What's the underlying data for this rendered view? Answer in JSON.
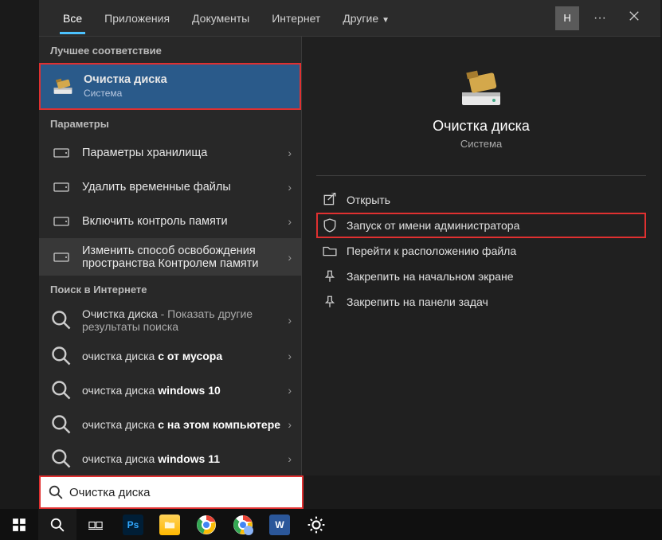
{
  "tabs": {
    "all": "Все",
    "apps": "Приложения",
    "docs": "Документы",
    "web": "Интернет",
    "other": "Другие"
  },
  "avatar_letter": "Н",
  "sections": {
    "best": "Лучшее соответствие",
    "settings": "Параметры",
    "web": "Поиск в Интернете"
  },
  "best_match": {
    "title": "Очистка диска",
    "subtitle": "Система"
  },
  "settings_items": [
    {
      "label": "Параметры хранилища"
    },
    {
      "label": "Удалить временные файлы"
    },
    {
      "label": "Включить контроль памяти"
    },
    {
      "label": "Изменить способ освобождения пространства Контролем памяти"
    }
  ],
  "web_items": [
    {
      "prefix": "Очистка диска",
      "suffix": " - Показать другие результаты поиска"
    },
    {
      "prefix": "очистка диска",
      "bold": " c от мусора"
    },
    {
      "prefix": "очистка диска",
      "bold": " windows 10"
    },
    {
      "prefix": "очистка диска",
      "bold": " c на этом компьютере"
    },
    {
      "prefix": "очистка диска",
      "bold": " windows 11"
    }
  ],
  "detail": {
    "title": "Очистка диска",
    "subtitle": "Система",
    "actions": [
      {
        "label": "Открыть",
        "icon": "open"
      },
      {
        "label": "Запуск от имени администратора",
        "icon": "shield",
        "highlight": true
      },
      {
        "label": "Перейти к расположению файла",
        "icon": "folder"
      },
      {
        "label": "Закрепить на начальном экране",
        "icon": "pin"
      },
      {
        "label": "Закрепить на панели задач",
        "icon": "pin"
      }
    ]
  },
  "search_value": "Очистка диска",
  "taskbar_apps": [
    {
      "name": "photoshop",
      "bg": "#001e36",
      "label": "Ps",
      "color": "#31a8ff"
    },
    {
      "name": "explorer",
      "bg": "#ffb900",
      "label": "",
      "color": "#fff"
    },
    {
      "name": "chrome",
      "bg": "",
      "label": "",
      "color": ""
    },
    {
      "name": "chrome2",
      "bg": "",
      "label": "",
      "color": ""
    },
    {
      "name": "word",
      "bg": "#2b579a",
      "label": "W",
      "color": "#fff"
    },
    {
      "name": "settings",
      "bg": "",
      "label": "",
      "color": ""
    }
  ]
}
